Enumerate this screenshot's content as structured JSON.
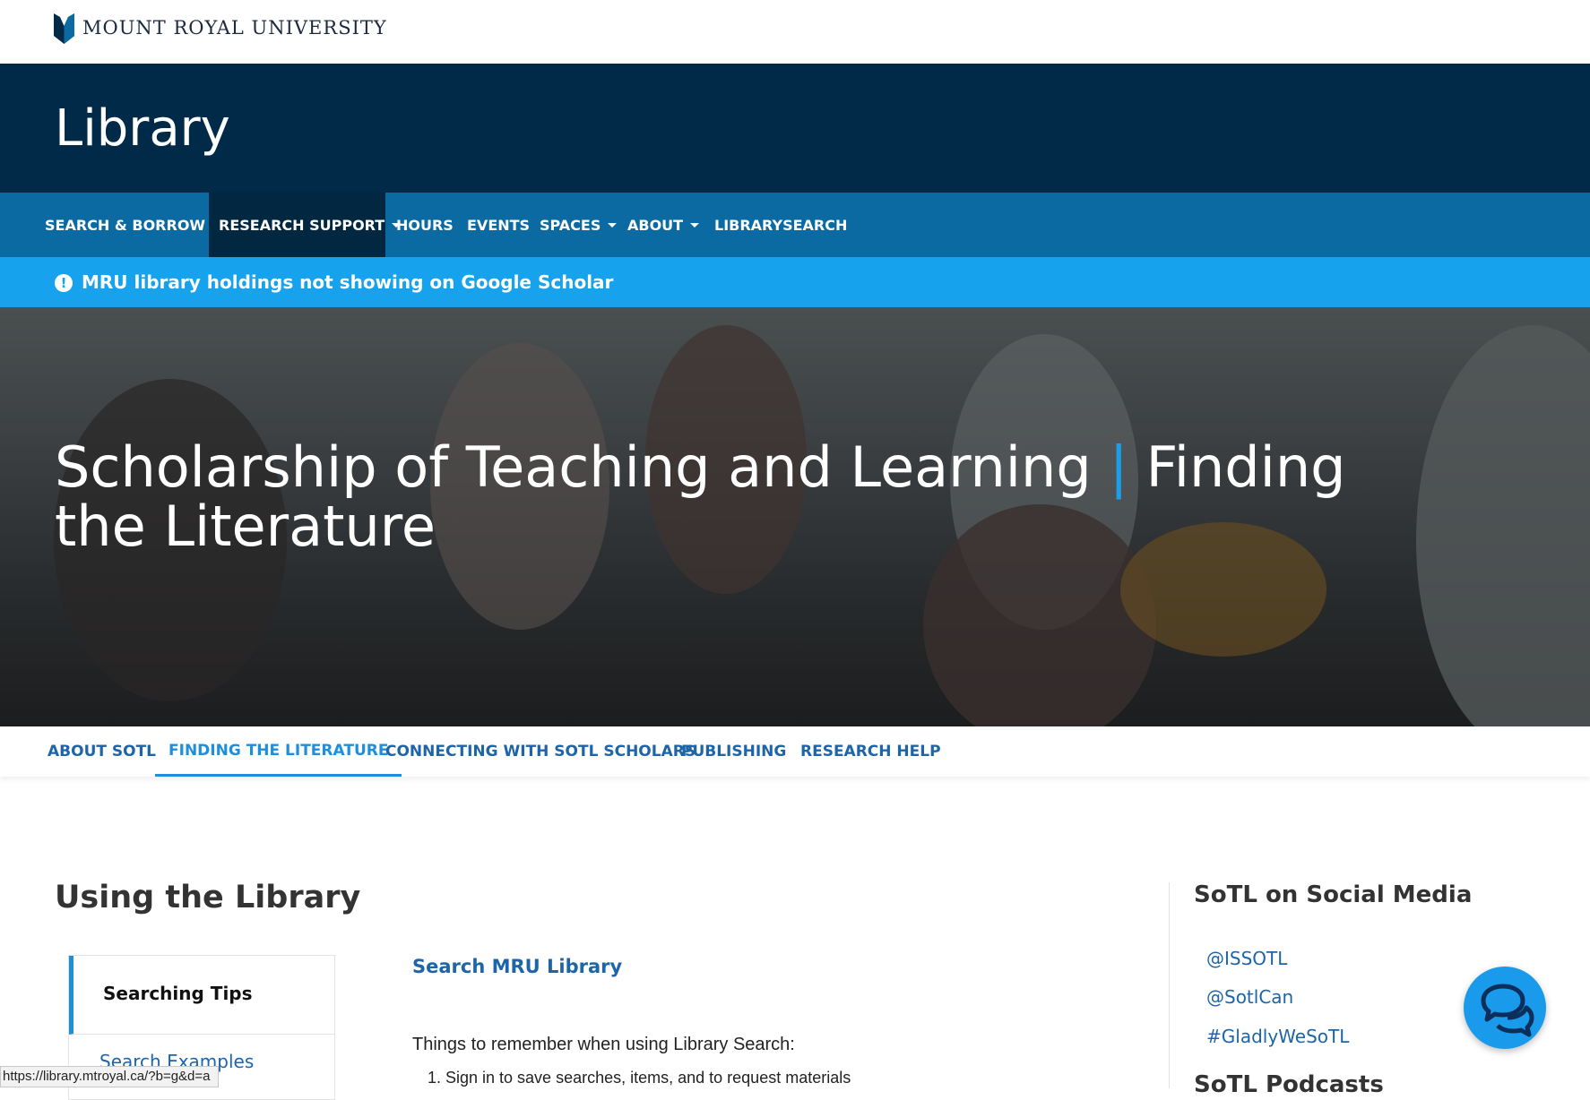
{
  "header": {
    "university_name": "MOUNT ROYAL UNIVERSITY",
    "logo_icon": "mru-shield-icon"
  },
  "banner": {
    "title": "Library"
  },
  "nav": {
    "items": [
      {
        "label": "SEARCH & BORROW",
        "dropdown": true
      },
      {
        "label": "RESEARCH SUPPORT",
        "dropdown": true,
        "active": true
      },
      {
        "label": "HOURS",
        "dropdown": false
      },
      {
        "label": "EVENTS",
        "dropdown": false
      },
      {
        "label": "SPACES",
        "dropdown": true
      },
      {
        "label": "ABOUT",
        "dropdown": true
      },
      {
        "label": "LIBRARYSEARCH",
        "dropdown": false
      }
    ]
  },
  "alert": {
    "icon": "exclamation-circle-icon",
    "text": "MRU library holdings not showing on Google Scholar"
  },
  "hero": {
    "title_main": "Scholarship of Teaching and Learning",
    "separator": "|",
    "title_sub": "Finding the Literature"
  },
  "subnav": {
    "items": [
      {
        "label": "ABOUT SOTL"
      },
      {
        "label": "FINDING THE LITERATURE",
        "active": true
      },
      {
        "label": "CONNECTING WITH SOTL SCHOLARS"
      },
      {
        "label": "PUBLISHING"
      },
      {
        "label": "RESEARCH HELP"
      }
    ]
  },
  "main": {
    "section_title": "Using the Library",
    "tips": {
      "active_label": "Searching Tips",
      "next_label": "Search Examples"
    },
    "search_link": "Search MRU Library",
    "intro_text": "Things to remember when using Library Search:",
    "list": [
      "Sign in to save searches, items, and to request materials"
    ]
  },
  "sidebar": {
    "title": "SoTL on Social Media",
    "links": [
      "@ISSOTL",
      "@SotlCan",
      "#GladlyWeSoTL"
    ],
    "next_title": "SoTL Podcasts"
  },
  "chat": {
    "icon": "chat-bubbles-icon"
  },
  "status_bar": {
    "url": "https://library.mtroyal.ca/?b=g&d=a"
  },
  "colors": {
    "banner": "#002a48",
    "nav": "#0b6aa2",
    "nav_active": "#012741",
    "alert": "#16a2ec",
    "link": "#1d65a8",
    "accent": "#1d8fdb"
  }
}
